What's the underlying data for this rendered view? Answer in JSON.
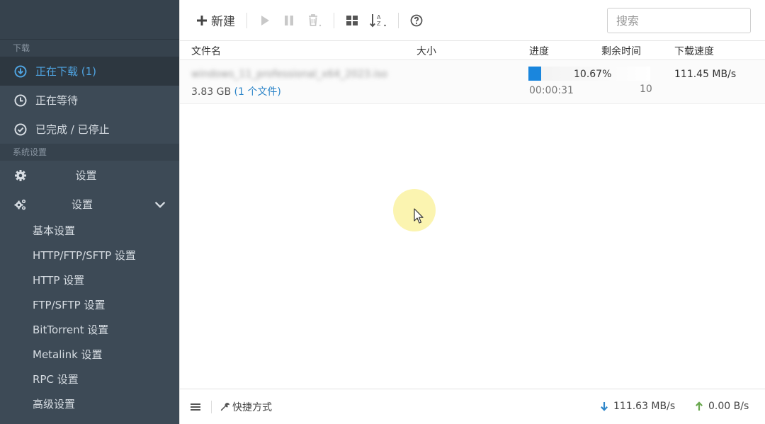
{
  "sidebar": {
    "section_download": "下载",
    "items": [
      {
        "label": "正在下载 (1)"
      },
      {
        "label": "正在等待"
      },
      {
        "label": "已完成 / 已停止"
      }
    ],
    "section_settings": "系统设置",
    "settings_item_1": "设置",
    "settings_item_2": "设置",
    "sub_items": [
      "基本设置",
      "HTTP/FTP/SFTP 设置",
      "HTTP 设置",
      "FTP/SFTP 设置",
      "BitTorrent 设置",
      "Metalink 设置",
      "RPC 设置",
      "高级设置"
    ]
  },
  "toolbar": {
    "new_label": "新建",
    "search_placeholder": "搜索"
  },
  "table": {
    "headers": {
      "name": "文件名",
      "size": "大小",
      "progress": "进度",
      "remaining": "剩余时间",
      "speed": "下载速度"
    },
    "tasks": [
      {
        "name": "windows_11_professional_x64_2023.iso",
        "size": "3.83 GB",
        "files": "(1 个文件)",
        "progress": 10.67,
        "progress_text": "10.67%",
        "time": "00:00:31",
        "connections": "10",
        "speed": "111.45 MB/s"
      }
    ]
  },
  "footer": {
    "shortcut_label": "快捷方式",
    "download_speed": "111.63 MB/s",
    "upload_speed": "0.00 B/s"
  },
  "colors": {
    "sidebar_bg": "#3d4a56",
    "active_item_text": "#4fa3e0",
    "progress_fill": "#1a86dd",
    "download_arrow": "#2e86c9",
    "upload_arrow": "#6aa84f"
  }
}
